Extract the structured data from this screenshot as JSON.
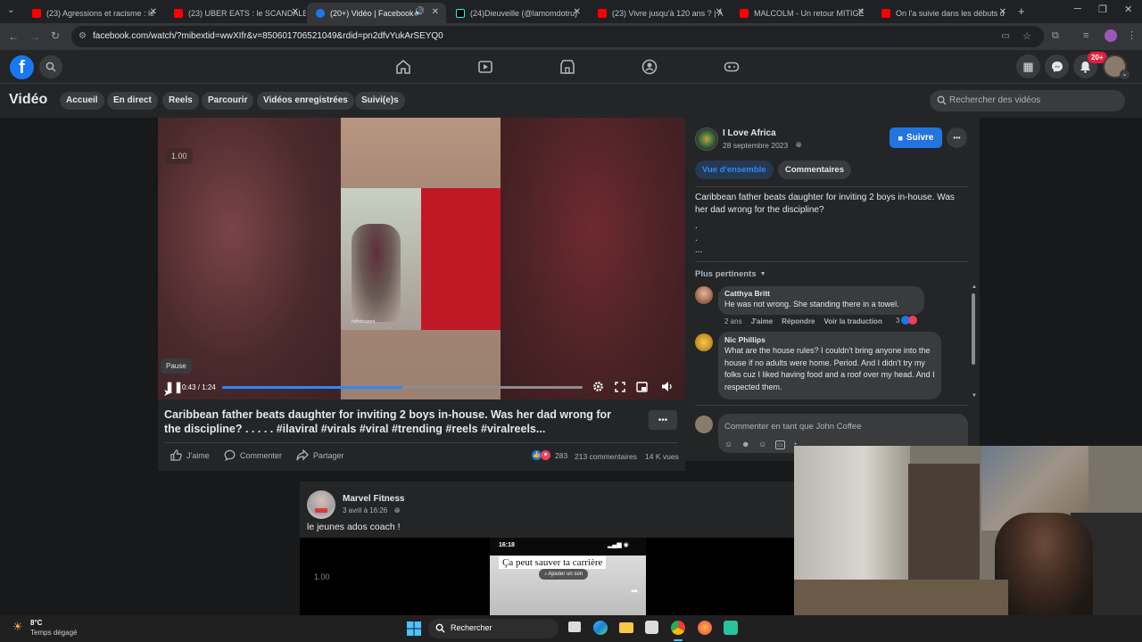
{
  "browser": {
    "tabs": [
      {
        "title": "(23) Agressions et racisme : le",
        "favicon_color": "#ff0000",
        "active": false
      },
      {
        "title": "(23) UBER EATS : le SCANDALE",
        "favicon_color": "#ff0000",
        "active": false
      },
      {
        "title": "(20+) Vidéo | Facebook",
        "favicon_color": "#1877f2",
        "active": true
      },
      {
        "title": "(24)Dieuveille (@lamomdotru)",
        "favicon_color": "#000000",
        "active": false
      },
      {
        "title": "(23) Vivre jusqu'à 120 ans ? | A",
        "favicon_color": "#ff0000",
        "active": false
      },
      {
        "title": "MALCOLM - Un retour MITIGÉ",
        "favicon_color": "#ff0000",
        "active": false
      },
      {
        "title": "On l'a suivie dans les débuts d",
        "favicon_color": "#ff0000",
        "active": false
      }
    ],
    "url": "facebook.com/watch/?mibextid=wwXIfr&v=850601706521049&rdid=pn2dfvYukArSEYQ0"
  },
  "header": {
    "logo": "f",
    "nav_icons": [
      "home-icon",
      "watch-icon",
      "marketplace-icon",
      "groups-icon",
      "gaming-icon"
    ],
    "notification_badge": "20+"
  },
  "video_nav": {
    "title": "Vidéo",
    "tabs": [
      "Accueil",
      "En direct",
      "Reels",
      "Parcourir",
      "Vidéos enregistrées",
      "Suivi(e)s"
    ],
    "search_placeholder": "Rechercher des vidéos"
  },
  "player": {
    "speed_badge": "1.00",
    "watermark": "ruthsboyent",
    "tooltip": "Pause",
    "time": "0:43 / 1:24",
    "progress": 0.5
  },
  "post": {
    "title": "Caribbean father beats daughter for inviting 2 boys in-house. Was her dad wrong for the discipline? . . . . . #ilaviral #virals #viral #trending #reels #viralreels...",
    "like_label": "J'aime",
    "comment_label": "Commenter",
    "share_label": "Partager",
    "reaction_count": "283",
    "comment_count": "213 commentaires",
    "views": "14 K vues"
  },
  "page_info": {
    "name": "I Love Africa",
    "date": "28 septembre 2023",
    "follow_label": "Suivre",
    "tab_overview": "Vue d'ensemble",
    "tab_comments": "Commentaires",
    "description": "Caribbean father beats daughter for inviting 2 boys in-house. Was her dad wrong for the discipline?",
    "dots": [
      ".",
      ".",
      "..."
    ],
    "sort_label": "Plus pertinents"
  },
  "comments": [
    {
      "author": "Catthya Britt",
      "text": "He was not wrong. She standing there in a towel.",
      "age": "2 ans",
      "like": "J'aime",
      "reply": "Répondre",
      "translate": "Voir la traduction",
      "reactions": "3"
    },
    {
      "author": "Nic Phillips",
      "text": "What are the house rules? I couldn't bring anyone into the house if no adults were home. Period. And I didn't try my folks cuz I liked having food and a roof over my head. And I respected them."
    }
  ],
  "comment_input": {
    "placeholder": "Commenter en tant que John Coffee"
  },
  "feed2": {
    "author": "Marvel Fitness",
    "date": "3 avril à 16:26",
    "text": "le jeunes ados coach !",
    "speed_badge": "1.00",
    "phone_time": "16:18",
    "overlay_text": "Ça peut sauver ta carrière",
    "sound_label": "Ajouter un son"
  },
  "taskbar": {
    "temperature": "8°C",
    "weather": "Temps dégagé",
    "search_label": "Rechercher"
  }
}
